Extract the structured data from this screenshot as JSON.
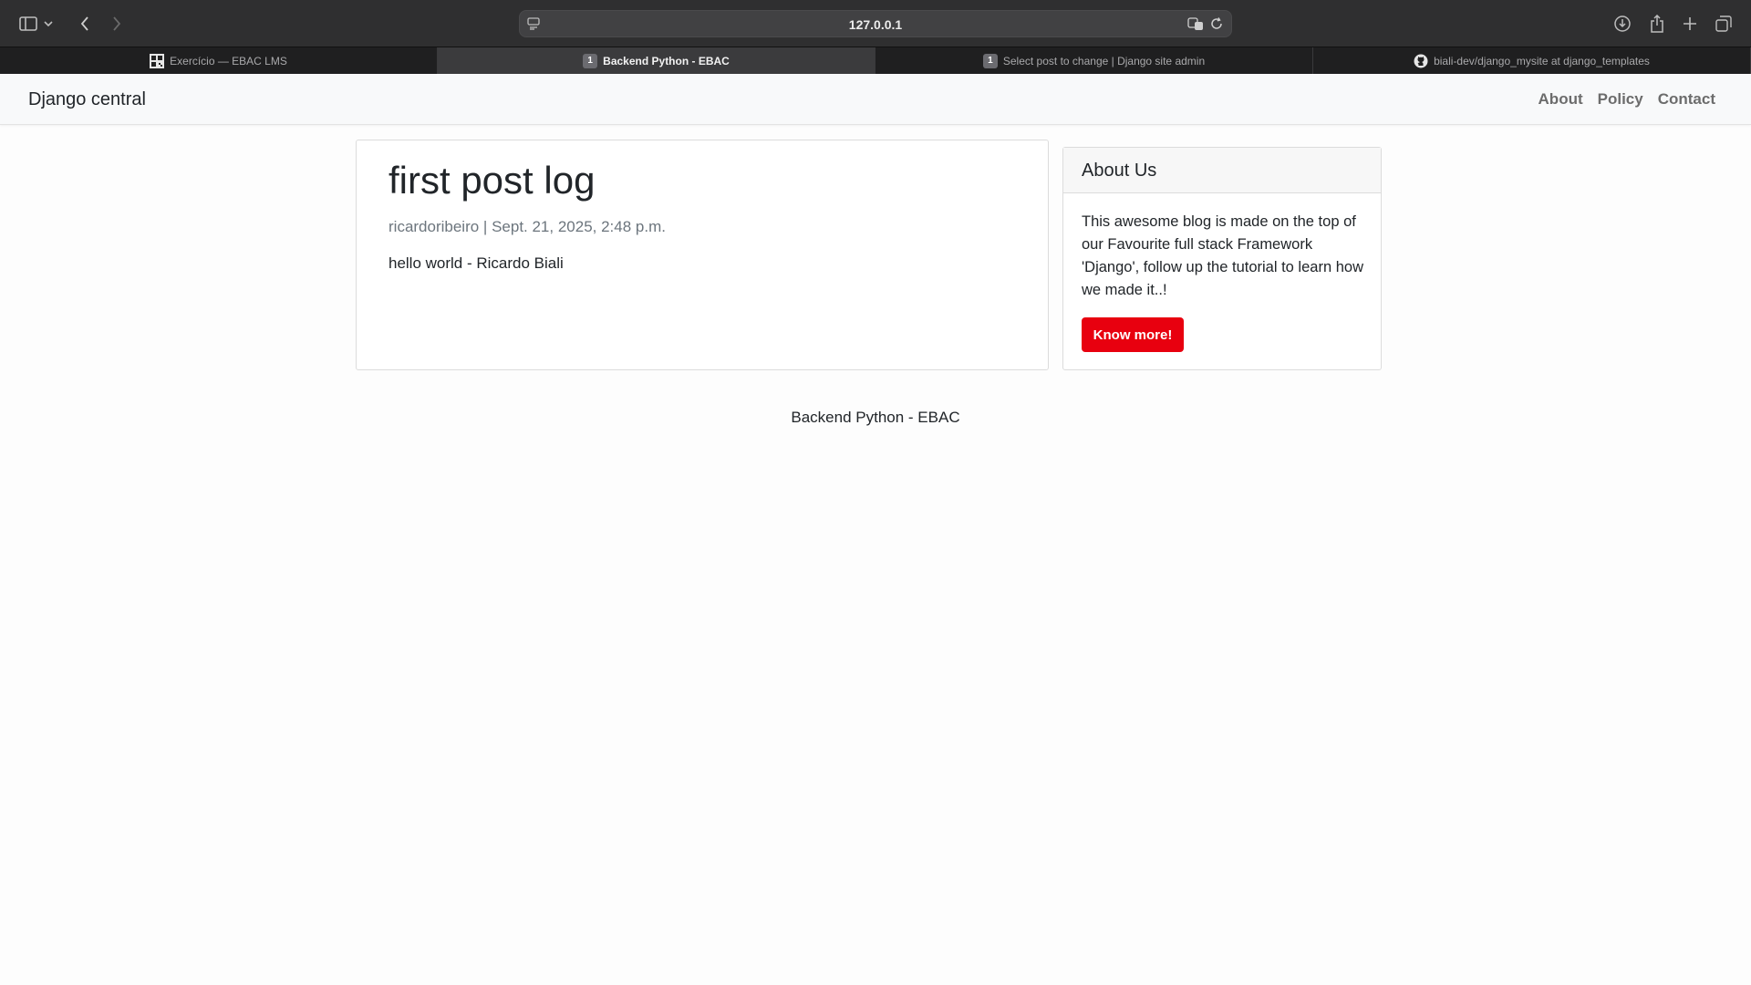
{
  "browser": {
    "url": "127.0.0.1",
    "tabs": [
      {
        "label": "Exercício — EBAC LMS",
        "favicon": "qr-icon",
        "active": false
      },
      {
        "label": "Backend Python - EBAC",
        "favicon_text": "1",
        "active": true
      },
      {
        "label": "Select post to change | Django site admin",
        "favicon_text": "1",
        "active": false
      },
      {
        "label": "biali-dev/django_mysite at django_templates",
        "favicon": "github-icon",
        "active": false
      }
    ]
  },
  "navbar": {
    "brand": "Django central",
    "links": [
      "About",
      "Policy",
      "Contact"
    ]
  },
  "post": {
    "title": "first post log",
    "meta": "ricardoribeiro | Sept. 21, 2025, 2:48 p.m.",
    "body": "hello world - Ricardo Biali"
  },
  "sidebar": {
    "header": "About Us",
    "text": "This awesome blog is made on the top of our Favourite full stack Framework 'Django', follow up the tutorial to learn how we made it..!",
    "button_label": "Know more!",
    "button_color": "#e8000f"
  },
  "footer": {
    "text": "Backend Python - EBAC"
  }
}
